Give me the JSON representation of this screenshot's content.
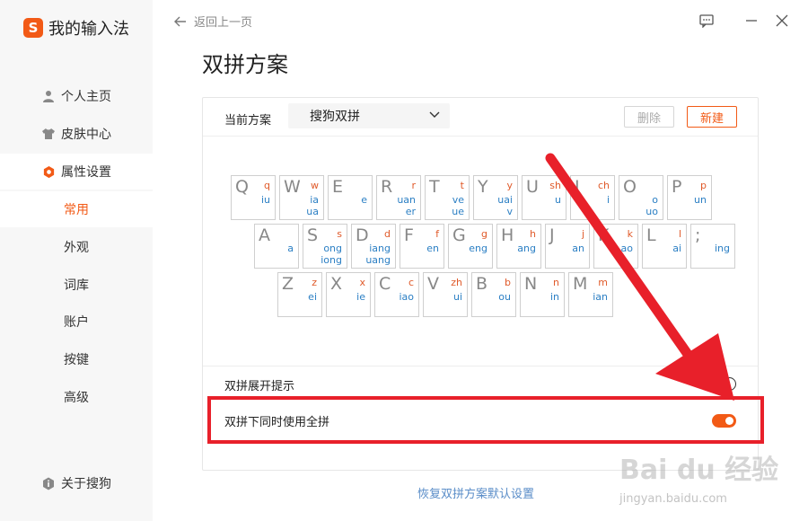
{
  "app": {
    "logo_letter": "S",
    "name": "我的输入法"
  },
  "sidebar": {
    "items": [
      {
        "label": "个人主页",
        "icon": "user-icon"
      },
      {
        "label": "皮肤中心",
        "icon": "shirt-icon"
      },
      {
        "label": "属性设置",
        "icon": "hexagon-settings-icon"
      }
    ],
    "subitems": [
      "常用",
      "外观",
      "词库",
      "账户",
      "按键",
      "高级"
    ],
    "about": "关于搜狗"
  },
  "topbar": {
    "back_label": "返回上一页"
  },
  "page": {
    "title": "双拼方案"
  },
  "scheme": {
    "label": "当前方案",
    "selected": "搜狗双拼",
    "delete_label": "删除",
    "new_label": "新建"
  },
  "keyboard": {
    "rows": [
      [
        {
          "k": "Q",
          "i": "q",
          "f1": "iu",
          "f2": ""
        },
        {
          "k": "W",
          "i": "w",
          "f1": "ia",
          "f2": "ua"
        },
        {
          "k": "E",
          "i": "",
          "f1": "e",
          "f2": ""
        },
        {
          "k": "R",
          "i": "r",
          "f1": "uan",
          "f2": "er"
        },
        {
          "k": "T",
          "i": "t",
          "f1": "ve",
          "f2": "ue"
        },
        {
          "k": "Y",
          "i": "y",
          "f1": "uai",
          "f2": "v"
        },
        {
          "k": "U",
          "i": "sh",
          "f1": "u",
          "f2": ""
        },
        {
          "k": "I",
          "i": "ch",
          "f1": "i",
          "f2": ""
        },
        {
          "k": "O",
          "i": "",
          "f1": "o",
          "f2": "uo"
        },
        {
          "k": "P",
          "i": "p",
          "f1": "un",
          "f2": ""
        }
      ],
      [
        {
          "k": "A",
          "i": "",
          "f1": "a",
          "f2": ""
        },
        {
          "k": "S",
          "i": "s",
          "f1": "ong",
          "f2": "iong"
        },
        {
          "k": "D",
          "i": "d",
          "f1": "iang",
          "f2": "uang"
        },
        {
          "k": "F",
          "i": "f",
          "f1": "en",
          "f2": ""
        },
        {
          "k": "G",
          "i": "g",
          "f1": "eng",
          "f2": ""
        },
        {
          "k": "H",
          "i": "h",
          "f1": "ang",
          "f2": ""
        },
        {
          "k": "J",
          "i": "j",
          "f1": "an",
          "f2": ""
        },
        {
          "k": "K",
          "i": "k",
          "f1": "ao",
          "f2": ""
        },
        {
          "k": "L",
          "i": "l",
          "f1": "ai",
          "f2": ""
        },
        {
          "k": ";",
          "i": "",
          "f1": "ing",
          "f2": ""
        }
      ],
      [
        {
          "k": "Z",
          "i": "z",
          "f1": "ei",
          "f2": ""
        },
        {
          "k": "X",
          "i": "x",
          "f1": "ie",
          "f2": ""
        },
        {
          "k": "C",
          "i": "c",
          "f1": "iao",
          "f2": ""
        },
        {
          "k": "V",
          "i": "zh",
          "f1": "ui",
          "f2": ""
        },
        {
          "k": "B",
          "i": "b",
          "f1": "ou",
          "f2": ""
        },
        {
          "k": "N",
          "i": "n",
          "f1": "in",
          "f2": ""
        },
        {
          "k": "M",
          "i": "m",
          "f1": "ian",
          "f2": ""
        }
      ]
    ]
  },
  "options": [
    {
      "label": "双拼展开提示",
      "on": false
    },
    {
      "label": "双拼下同时使用全拼",
      "on": true
    }
  ],
  "restore_label": "恢复双拼方案默认设置",
  "watermark": {
    "brand": "Bai du 经验",
    "url": "jingyan.baidu.com"
  },
  "colors": {
    "accent": "#f25a16",
    "annotation": "#e8202a",
    "final_text": "#2b7fc4",
    "initial_text": "#e05a2a",
    "link": "#5a8dc8"
  }
}
